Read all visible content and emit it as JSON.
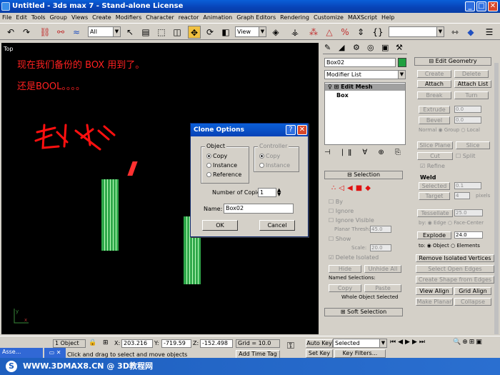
{
  "window": {
    "title": "Untitled - 3ds max 7 - Stand-alone License"
  },
  "menu": [
    "File",
    "Edit",
    "Tools",
    "Group",
    "Views",
    "Create",
    "Modifiers",
    "Character",
    "reactor",
    "Animation",
    "Graph Editors",
    "Rendering",
    "Customize",
    "MAXScript",
    "Help"
  ],
  "toolbar": {
    "filter": "All",
    "coord": "View"
  },
  "viewport": {
    "label": "Top",
    "note1": "现在我们备份的  BOX  用到了。",
    "note2": "还是BOOL。。。。"
  },
  "dialog": {
    "title": "Clone Options",
    "object_group": "Object",
    "controller_group": "Controller",
    "object_options": [
      "Copy",
      "Instance",
      "Reference"
    ],
    "controller_options": [
      "Copy",
      "Instance"
    ],
    "copies_label": "Number of Copies:",
    "copies_value": "1",
    "name_label": "Name:",
    "name_value": "Box02",
    "ok": "OK",
    "cancel": "Cancel"
  },
  "cmd": {
    "object_name": "Box02",
    "modifier_list": "Modifier List",
    "stack_item": "Edit Mesh",
    "stack_base": "Box",
    "selection_head": "Selection",
    "ignore_backfacing": "By",
    "ignore_vertex": "Ignore",
    "ignore_visible": "Ignore Visible",
    "planar_thresh": "Planar Thresh:",
    "planar_value": "45.0",
    "show": "Show",
    "scale": "Scale:",
    "scale_value": "20.0",
    "delete_isolated": "Delete Isolated",
    "hide": "Hide",
    "unhide": "Unhide All",
    "named_sel": "Named Selections:",
    "copy": "Copy",
    "paste": "Paste",
    "whole": "Whole Object Selected",
    "soft": "Soft Selection"
  },
  "edit_geometry": {
    "head": "Edit Geometry",
    "create": "Create",
    "delete": "Delete",
    "attach": "Attach",
    "attach_list": "Attach List",
    "break": "Break",
    "turn": "Turn",
    "extrude": "Extrude",
    "extrude_v": "0.0",
    "bevel": "Bevel",
    "bevel_v": "0.0",
    "normal": "Normal",
    "group": "Group",
    "local": "Local",
    "slice_plane": "Slice Plane",
    "slice": "Slice",
    "cut": "Cut",
    "split": "Split",
    "refine": "Refine",
    "weld": "Weld",
    "selected": "Selected",
    "selected_v": "0.1",
    "target": "Target",
    "target_v": "4",
    "pixels": "pixels",
    "tessellate": "Tessellate",
    "tess_v": "25.0",
    "by": "by:",
    "edge": "Edge",
    "face_center": "Face-Center",
    "explode": "Explode",
    "explode_v": "24.0",
    "to": "to:",
    "object": "Object",
    "elements": "Elements",
    "remove_iso": "Remove Isolated Vertices",
    "sel_open": "Select Open Edges",
    "create_shape": "Create Shape from Edges",
    "view_align": "View Align",
    "grid_align": "Grid Align",
    "make_planar": "Make Planar",
    "collapse": "Collapse"
  },
  "status": {
    "selected": "1 Object",
    "x": "203.216",
    "y": "-719.59",
    "z": "-152.498",
    "grid": "Grid = 10.0",
    "autokey": "Auto Key",
    "setkey": "Set Key",
    "key_sel": "Selected",
    "key_filters": "Key Filters...",
    "prompt": "Click and drag to select and move objects",
    "add_time": "Add Time Tag",
    "task": "Asse..."
  },
  "banner": "WWW.3DMAX8.CN @ 3D教程网"
}
